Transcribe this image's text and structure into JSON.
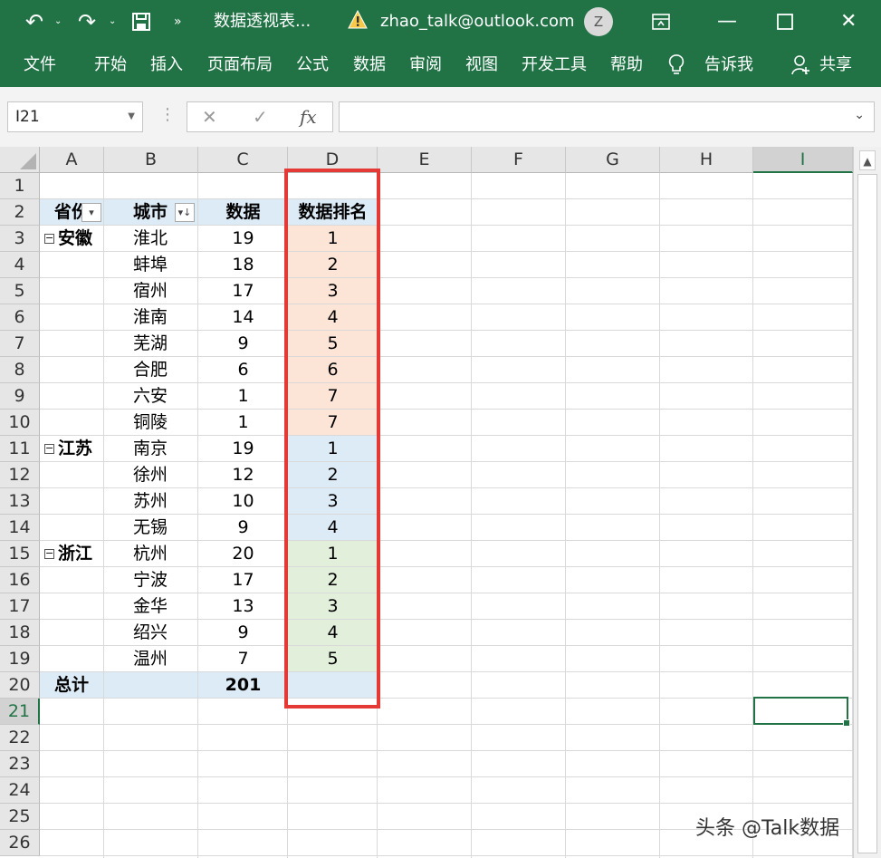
{
  "titlebar": {
    "undo_icon": "undo-icon",
    "redo_icon": "redo-icon",
    "save_icon": "save-icon",
    "more_icon": "more-icon",
    "file_title": "数据透视表...",
    "account": "zhao_talk@outlook.com",
    "avatar_letter": "Z",
    "background_color": "#217346"
  },
  "ribbon_tabs": [
    "文件",
    "开始",
    "插入",
    "页面布局",
    "公式",
    "数据",
    "审阅",
    "视图",
    "开发工具",
    "帮助",
    "告诉我",
    "共享"
  ],
  "formula_bar": {
    "name_box": "I21",
    "cancel": "✕",
    "enter": "✓",
    "fx": "fx",
    "value": ""
  },
  "columns": [
    "A",
    "B",
    "C",
    "D",
    "E",
    "F",
    "G",
    "H",
    "I"
  ],
  "rows": [
    "1",
    "2",
    "3",
    "4",
    "5",
    "6",
    "7",
    "8",
    "9",
    "10",
    "11",
    "12",
    "13",
    "14",
    "15",
    "16",
    "17",
    "18",
    "19",
    "20",
    "21",
    "22",
    "23",
    "24",
    "25",
    "26"
  ],
  "pivot": {
    "header_province": "省份",
    "header_city": "城市",
    "header_data": "数据",
    "header_rank": "数据排名",
    "groups": [
      {
        "province": "安徽",
        "color": "#fce4d6",
        "cities": [
          {
            "city": "淮北",
            "data": "19",
            "rank": "1"
          },
          {
            "city": "蚌埠",
            "data": "18",
            "rank": "2"
          },
          {
            "city": "宿州",
            "data": "17",
            "rank": "3"
          },
          {
            "city": "淮南",
            "data": "14",
            "rank": "4"
          },
          {
            "city": "芜湖",
            "data": "9",
            "rank": "5"
          },
          {
            "city": "合肥",
            "data": "6",
            "rank": "6"
          },
          {
            "city": "六安",
            "data": "1",
            "rank": "7"
          },
          {
            "city": "铜陵",
            "data": "1",
            "rank": "7"
          }
        ]
      },
      {
        "province": "江苏",
        "color": "#ddebf7",
        "cities": [
          {
            "city": "南京",
            "data": "19",
            "rank": "1"
          },
          {
            "city": "徐州",
            "data": "12",
            "rank": "2"
          },
          {
            "city": "苏州",
            "data": "10",
            "rank": "3"
          },
          {
            "city": "无锡",
            "data": "9",
            "rank": "4"
          }
        ]
      },
      {
        "province": "浙江",
        "color": "#e2efda",
        "cities": [
          {
            "city": "杭州",
            "data": "20",
            "rank": "1"
          },
          {
            "city": "宁波",
            "data": "17",
            "rank": "2"
          },
          {
            "city": "金华",
            "data": "13",
            "rank": "3"
          },
          {
            "city": "绍兴",
            "data": "9",
            "rank": "4"
          },
          {
            "city": "温州",
            "data": "7",
            "rank": "5"
          }
        ]
      }
    ],
    "total_label": "总计",
    "total_value": "201",
    "header_bg": "#ddebf7",
    "highlight_border": "#e53935"
  },
  "watermark": "头条 @Talk数据"
}
